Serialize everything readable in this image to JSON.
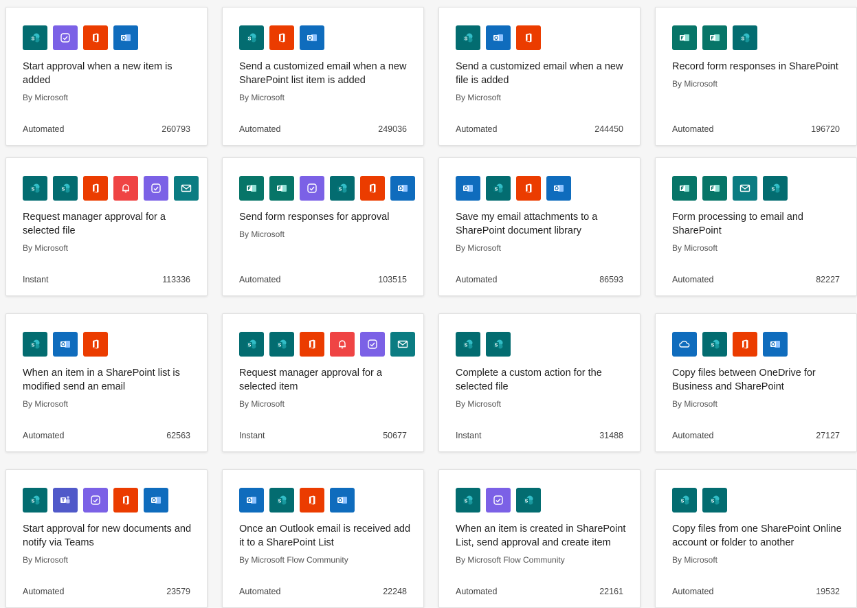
{
  "colors": {
    "sharepoint": "#036c70",
    "approvals": "#7b61e6",
    "office": "#eb3c00",
    "outlook": "#0f6cbd",
    "forms": "#077568",
    "notification": "#ef4444",
    "mail": "#0b7c82",
    "teams": "#5059c9",
    "onedrive": "#0f6cbd"
  },
  "cards": [
    {
      "title": "Start approval when a new item is added",
      "author": "By Microsoft",
      "type": "Automated",
      "count": "260793",
      "icons": [
        "sharepoint-icon",
        "approvals-icon",
        "office-icon",
        "outlook-icon"
      ]
    },
    {
      "title": "Send a customized email when a new SharePoint list item is added",
      "author": "By Microsoft",
      "type": "Automated",
      "count": "249036",
      "icons": [
        "sharepoint-icon",
        "office-icon",
        "outlook-icon"
      ]
    },
    {
      "title": "Send a customized email when a new file is added",
      "author": "By Microsoft",
      "type": "Automated",
      "count": "244450",
      "icons": [
        "sharepoint-icon",
        "outlook-icon",
        "office-icon"
      ]
    },
    {
      "title": "Record form responses in SharePoint",
      "author": "By Microsoft",
      "type": "Automated",
      "count": "196720",
      "icons": [
        "forms-icon",
        "forms-icon",
        "sharepoint-icon"
      ]
    },
    {
      "title": "Request manager approval for a selected file",
      "author": "By Microsoft",
      "type": "Instant",
      "count": "113336",
      "icons": [
        "sharepoint-icon",
        "sharepoint-icon",
        "office-icon",
        "notification-icon",
        "approvals-icon",
        "mail-icon"
      ]
    },
    {
      "title": "Send form responses for approval",
      "author": "By Microsoft",
      "type": "Automated",
      "count": "103515",
      "icons": [
        "forms-icon",
        "forms-icon",
        "approvals-icon",
        "sharepoint-icon",
        "office-icon",
        "outlook-icon"
      ]
    },
    {
      "title": "Save my email attachments to a SharePoint document library",
      "author": "By Microsoft",
      "type": "Automated",
      "count": "86593",
      "icons": [
        "outlook-icon",
        "sharepoint-icon",
        "office-icon",
        "outlook-icon"
      ]
    },
    {
      "title": "Form processing to email and SharePoint",
      "author": "By Microsoft",
      "type": "Automated",
      "count": "82227",
      "icons": [
        "forms-icon",
        "forms-icon",
        "mail-icon",
        "sharepoint-icon"
      ]
    },
    {
      "title": "When an item in a SharePoint list is modified send an email",
      "author": "By Microsoft",
      "type": "Automated",
      "count": "62563",
      "icons": [
        "sharepoint-icon",
        "outlook-icon",
        "office-icon"
      ]
    },
    {
      "title": "Request manager approval for a selected item",
      "author": "By Microsoft",
      "type": "Instant",
      "count": "50677",
      "icons": [
        "sharepoint-icon",
        "sharepoint-icon",
        "office-icon",
        "notification-icon",
        "approvals-icon",
        "mail-icon"
      ]
    },
    {
      "title": "Complete a custom action for the selected file",
      "author": "By Microsoft",
      "type": "Instant",
      "count": "31488",
      "icons": [
        "sharepoint-icon",
        "sharepoint-icon"
      ]
    },
    {
      "title": "Copy files between OneDrive for Business and SharePoint",
      "author": "By Microsoft",
      "type": "Automated",
      "count": "27127",
      "icons": [
        "onedrive-icon",
        "sharepoint-icon",
        "office-icon",
        "outlook-icon"
      ]
    },
    {
      "title": "Start approval for new documents and notify via Teams",
      "author": "By Microsoft",
      "type": "Automated",
      "count": "23579",
      "icons": [
        "sharepoint-icon",
        "teams-icon",
        "approvals-icon",
        "office-icon",
        "outlook-icon"
      ]
    },
    {
      "title": "Once an Outlook email is received add it to a SharePoint List",
      "author": "By Microsoft Flow Community",
      "type": "Automated",
      "count": "22248",
      "icons": [
        "outlook-icon",
        "sharepoint-icon",
        "office-icon",
        "outlook-icon"
      ]
    },
    {
      "title": "When an item is created in SharePoint List, send approval and create item",
      "author": "By Microsoft Flow Community",
      "type": "Automated",
      "count": "22161",
      "icons": [
        "sharepoint-icon",
        "approvals-icon",
        "sharepoint-icon"
      ]
    },
    {
      "title": "Copy files from one SharePoint Online account or folder to another",
      "author": "By Microsoft",
      "type": "Automated",
      "count": "19532",
      "icons": [
        "sharepoint-icon",
        "sharepoint-icon"
      ]
    }
  ]
}
